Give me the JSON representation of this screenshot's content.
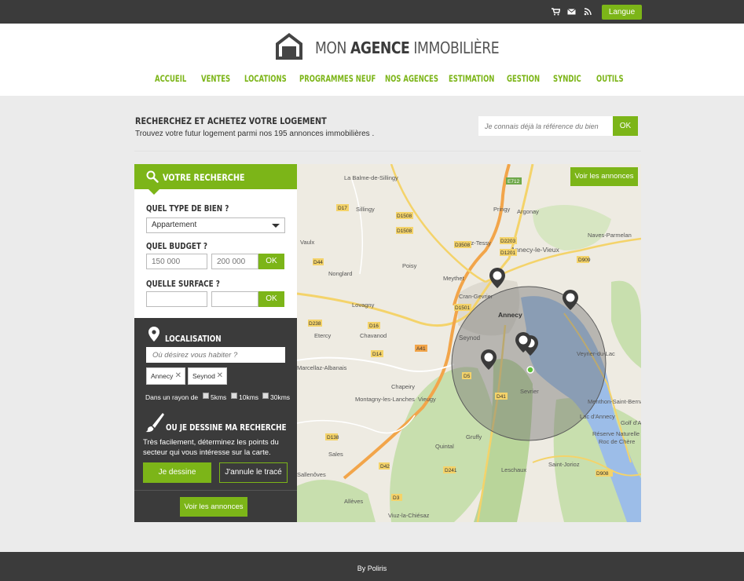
{
  "topbar": {
    "icons": [
      "cart-icon",
      "mail-icon",
      "rss-icon"
    ],
    "lang_label": "Langue"
  },
  "brand": {
    "word1": "MON ",
    "word2": "AGENCE",
    "word3": " IMMOBILIÈRE"
  },
  "nav": {
    "items": [
      "ACCUEIL",
      "VENTES",
      "LOCATIONS",
      "PROGRAMMES NEUF",
      "NOS AGENCES",
      "ESTIMATION",
      "GESTION",
      "SYNDIC",
      "OUTILS"
    ]
  },
  "hero": {
    "title": "RECHERCHEZ ET ACHETEZ VOTRE LOGEMENT",
    "subtitle": "Trouvez votre futur logement parmi nos 195 annonces immobilières .",
    "ref_placeholder": "Je connais déjà la référence du bien",
    "ref_ok": "OK"
  },
  "search": {
    "title": "VOTRE RECHERCHE",
    "type_label": "QUEL TYPE DE BIEN ?",
    "type_value": "Appartement",
    "budget_label": "QUEL BUDGET ?",
    "budget_min_placeholder": "150 000",
    "budget_max_placeholder": "200 000",
    "budget_ok": "OK",
    "surface_label": "QUELLE SURFACE ?",
    "surface_ok": "OK"
  },
  "location": {
    "title": "LOCALISATION",
    "placeholder": "Où désirez vous habiter ?",
    "tags": [
      "Annecy",
      "Seynod"
    ],
    "radius_label": "Dans un rayon de",
    "radius_options": [
      "5kms",
      "10kms",
      "30kms"
    ]
  },
  "draw": {
    "title": "OU JE DESSINE MA RECHERCHE",
    "description": "Très facilement, déterminez les points du secteur qui vous intéresse sur la carte.",
    "draw_button": "Je dessine",
    "cancel_button": "J'annule le tracé",
    "see_button": "Voir les annonces"
  },
  "map": {
    "see_button": "Voir les annonces",
    "places": [
      "La Balme-de-Sillingy",
      "Sillingy",
      "Pringy",
      "Argonay",
      "Metz-Tessy",
      "Naves-Parmelan",
      "Annecy-le-Vieux",
      "Poisy",
      "Meythet",
      "Nonglard",
      "Cran-Gevrier",
      "Annecy",
      "Seynod",
      "Vaulx",
      "Lovagny",
      "Chavanod",
      "Etercy",
      "Veyrier-du-Lac",
      "Menthon-Saint-Bernard",
      "Sevrier",
      "Montagny-les-Lanches",
      "Viuz-la-Chiésaz",
      "Saint-Jorioz",
      "Réserve Naturelle",
      "Roc de Chère",
      "Quintal",
      "Leschaux",
      "Allèves",
      "Sales",
      "Vieugy",
      "Chapeiry",
      "Gruffy",
      "Sallenôves",
      "Golf d'Annecy",
      "Lac d'Annecy",
      "Marcellaz-Albanais"
    ],
    "roads": [
      "E712",
      "D1508",
      "D1201",
      "D5",
      "D16",
      "D14",
      "D3508",
      "D1501",
      "D17",
      "D1508",
      "D908",
      "A41",
      "D2203",
      "D909",
      "D909A",
      "D41",
      "D38",
      "D138",
      "D241",
      "D44",
      "D238",
      "D3",
      "D31",
      "D42"
    ],
    "colors": {
      "water": "#9cbde8",
      "land": "#eeebe2",
      "forest": "#c8dfae",
      "road": "#f4d36a",
      "highway": "#f2a54a",
      "circle": "#767676"
    }
  },
  "footer": {
    "text": "By Poliris"
  },
  "colors": {
    "accent": "#7cb518",
    "dark": "#3b3b3b",
    "background": "#ebebeb"
  }
}
